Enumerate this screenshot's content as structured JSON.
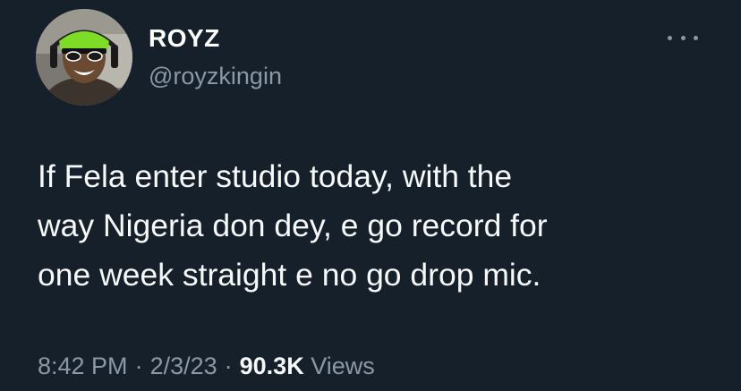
{
  "author": {
    "display_name": "ROYZ",
    "handle": "@royzkingin",
    "avatar_icon": "profile-photo"
  },
  "more_icon": "more-horizontal-icon",
  "tweet": {
    "text": "If Fela enter studio today, with the\nway Nigeria don dey, e go record for\none week straight e no go drop mic."
  },
  "meta": {
    "time": "8:42 PM",
    "separator": "·",
    "date": "2/3/23",
    "views_count": "90.3K",
    "views_label": "Views"
  },
  "colors": {
    "background": "#15202b",
    "text_primary": "#f7f9f9",
    "text_secondary": "#8b98a5"
  }
}
